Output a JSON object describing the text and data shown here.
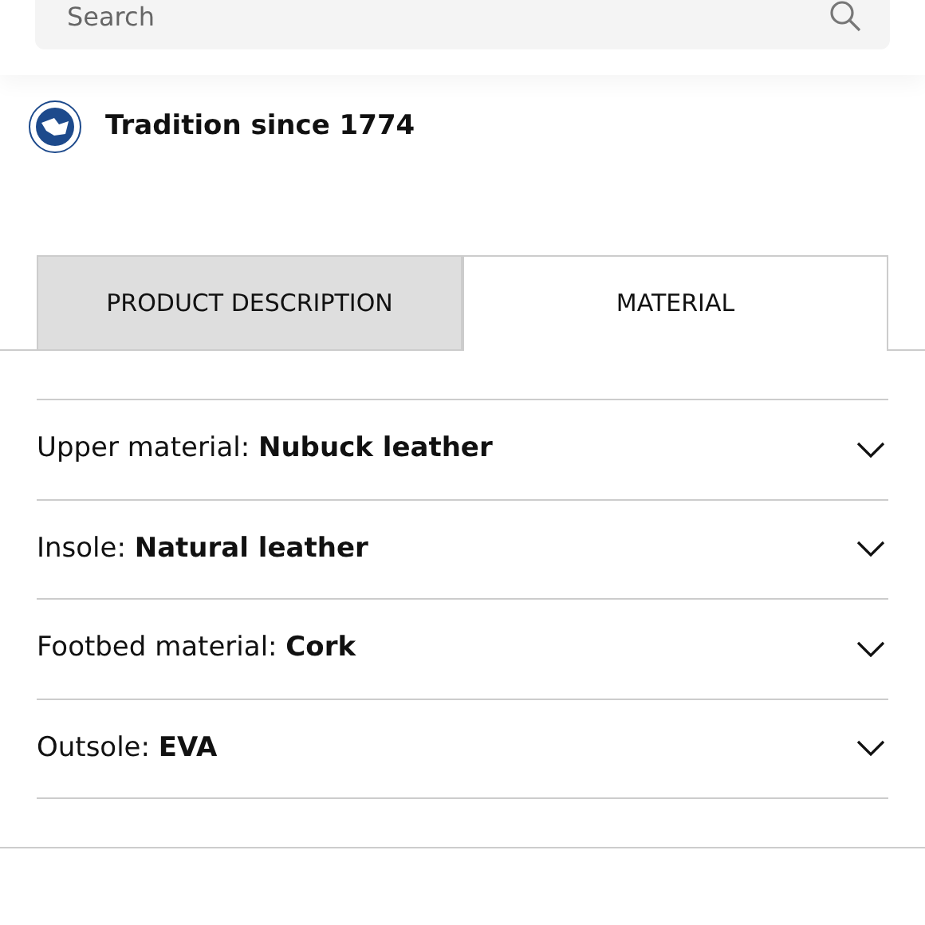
{
  "search": {
    "placeholder": "Search"
  },
  "brand": {
    "tagline": "Tradition since 1774"
  },
  "tabs": [
    {
      "label": "PRODUCT DESCRIPTION",
      "selected": false
    },
    {
      "label": "MATERIAL",
      "selected": true
    }
  ],
  "materials": [
    {
      "label": "Upper material: **Nubuck leather**",
      "expanded": false
    },
    {
      "label": "Insole: **Natural leather**",
      "expanded": false
    },
    {
      "label": "Footbed material: **Cork**",
      "expanded": false
    },
    {
      "label": "Outsole: **EVA**",
      "expanded": false
    }
  ]
}
